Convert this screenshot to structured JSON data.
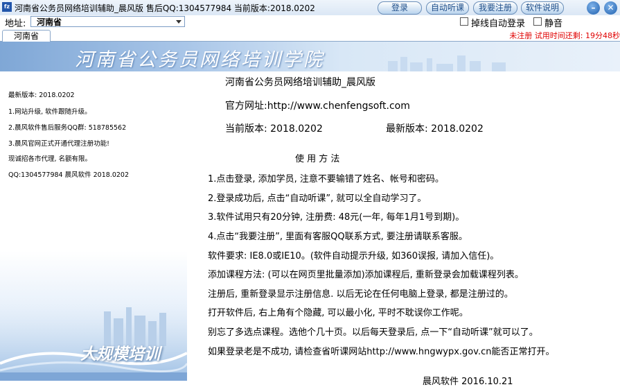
{
  "titlebar": {
    "icon_text": "fz",
    "title": "河南省公务员网络培训辅助_晨风版 售后QQ:1304577984 当前版本:2018.0202",
    "buttons": [
      "登录",
      "自动听课",
      "我要注册",
      "软件说明"
    ],
    "minimize": "–",
    "close": "✕"
  },
  "address": {
    "label": "地址:",
    "selected": "河南省",
    "auto_login_label": "掉线自动登录",
    "mute_label": "静音"
  },
  "tabs": {
    "active": "河南省",
    "trial_notice": "未注册 试用时间还剩: 19分48秒"
  },
  "banner": {
    "title": "河南省公务员网络培训学院"
  },
  "left_news": [
    "最新版本: 2018.0202",
    "1.网站升级, 软件跟随升级。",
    "2.晨风软件售后服务QQ群: 518785562",
    "3.晨风官网正式开通代理注册功能!",
    "  现诚招各市代理, 名额有限。",
    "  QQ:1304577984   晨风软件 2018.0202"
  ],
  "left_footer": "大规模培训",
  "main": {
    "heading": "河南省公务员网络培训辅助_晨风版",
    "website_label": "官方网址:http://www.chenfengsoft.com",
    "current_version": "当前版本: 2018.0202",
    "latest_version": "最新版本: 2018.0202",
    "usage_title": "使 用 方 法",
    "lines": [
      "1.点击登录, 添加学员, 注意不要输错了姓名、帐号和密码。",
      "2.登录成功后, 点击“自动听课”, 就可以全自动学习了。",
      "3.软件试用只有20分钟, 注册费: 48元(一年, 每年1月1号到期)。",
      "4.点击“我要注册”, 里面有客服QQ联系方式, 要注册请联系客服。",
      "     软件要求: IE8.0或IE10。(软件自动提示升级, 如360误报, 请加入信任)。",
      "添加课程方法: (可以在网页里批量添加)添加课程后, 重新登录会加载课程列表。",
      "注册后, 重新登录显示注册信息. 以后无论在任何电脑上登录, 都是注册过的。",
      "打开软件后, 右上角有个隐藏, 可以最小化, 平时不耽误你工作呢。",
      "别忘了多选点课程。选他个几十页。以后每天登录后, 点一下“自动听课”就可以了。",
      "如果登录老是不成功, 请检查省听课网站http://www.hngwypx.gov.cn能否正常打开。"
    ],
    "footer": "晨风软件    2016.10.21"
  }
}
